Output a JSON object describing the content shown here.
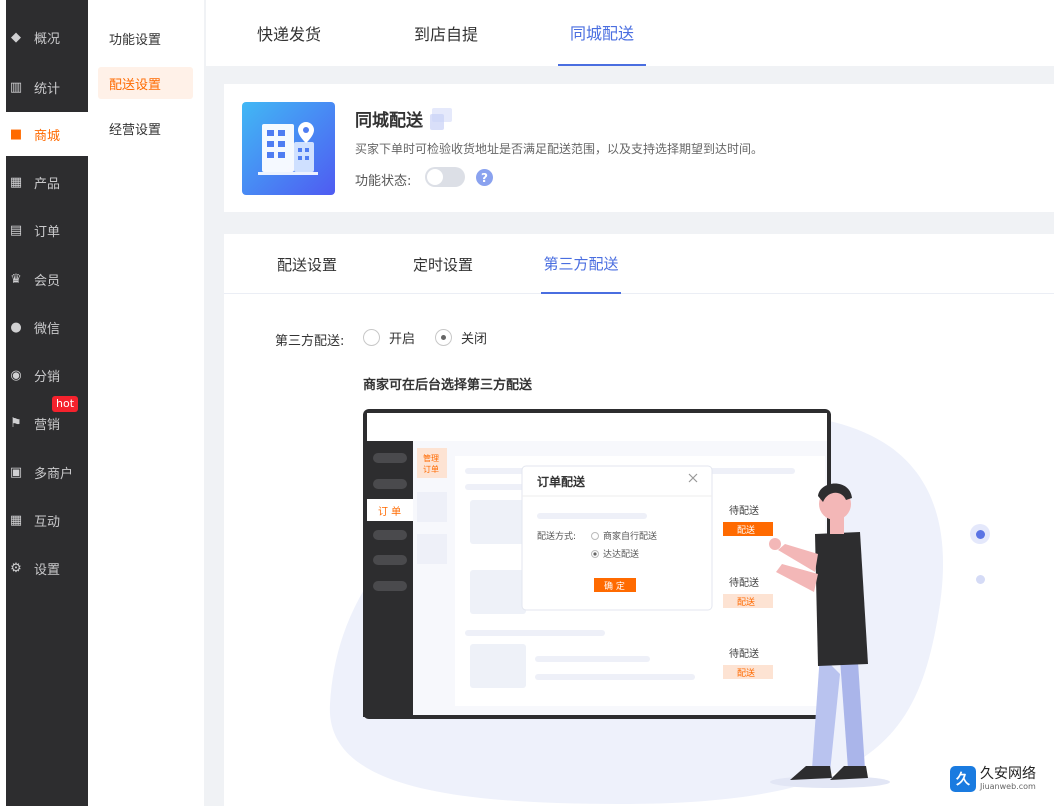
{
  "sidebar": {
    "items": [
      {
        "label": "概况",
        "icon": "layers-icon",
        "glyph": "◆"
      },
      {
        "label": "统计",
        "icon": "chart-icon",
        "glyph": "▥"
      },
      {
        "label": "商城",
        "icon": "store-icon",
        "glyph": "■"
      },
      {
        "label": "产品",
        "icon": "grid-icon",
        "glyph": "▦"
      },
      {
        "label": "订单",
        "icon": "clipboard-icon",
        "glyph": "▤"
      },
      {
        "label": "会员",
        "icon": "crown-icon",
        "glyph": "♛"
      },
      {
        "label": "微信",
        "icon": "wechat-icon",
        "glyph": "●"
      },
      {
        "label": "分销",
        "icon": "share-user-icon",
        "glyph": "◉"
      },
      {
        "label": "营销",
        "icon": "flag-icon",
        "glyph": "⚑"
      },
      {
        "label": "多商户",
        "icon": "multi-store-icon",
        "glyph": "▣"
      },
      {
        "label": "互动",
        "icon": "users-icon",
        "glyph": "▦"
      },
      {
        "label": "设置",
        "icon": "gear-icon",
        "glyph": "⚙"
      }
    ],
    "hot_badge": "hot"
  },
  "submenu": {
    "items": [
      "功能设置",
      "配送设置",
      "经营设置"
    ]
  },
  "top_tabs": [
    "快递发货",
    "到店自提",
    "同城配送"
  ],
  "card": {
    "title": "同城配送",
    "desc": "买家下单时可检验收货地址是否满足配送范围，以及支持选择期望到达时间。",
    "status_label": "功能状态:",
    "help": "?"
  },
  "sub_tabs": [
    "配送设置",
    "定时设置",
    "第三方配送"
  ],
  "third_party": {
    "label": "第三方配送:",
    "options": [
      "开启",
      "关闭"
    ],
    "selected": "关闭"
  },
  "illustration": {
    "title": "商家可在后台选择第三方配送",
    "menu_label": "订 单",
    "manage_label_1": "管理",
    "manage_label_2": "订单",
    "dialog_title": "订单配送",
    "method_label": "配送方式:",
    "option_1": "商家自行配送",
    "option_2": "达达配送",
    "confirm": "确 定",
    "pending": "待配送",
    "deliver": "配送"
  },
  "watermark": {
    "logo": "久",
    "name": "久安网络",
    "url": "Jiuanweb.com"
  },
  "colors": {
    "accent_orange": "#ff6a00",
    "accent_blue": "#4a6ee0",
    "sidebar_bg": "#2d2d2f"
  }
}
